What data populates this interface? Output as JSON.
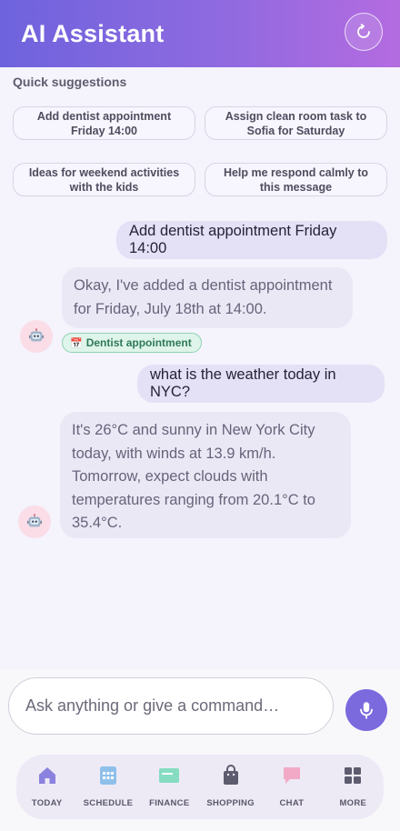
{
  "header": {
    "title": "AI Assistant",
    "refresh_icon": "refresh-icon"
  },
  "suggestions": {
    "label": "Quick suggestions",
    "chips": [
      {
        "line1": "Add dentist appointment",
        "line2": "Friday 14:00"
      },
      {
        "line1": "Assign clean room task to",
        "line2": "Sofia for Saturday"
      },
      {
        "line1": "Ideas for weekend activities",
        "line2": "with the kids"
      },
      {
        "line1": "Help me respond calmly to",
        "line2": "this message"
      }
    ]
  },
  "messages": [
    {
      "role": "user",
      "text": "Add dentist appointment Friday 14:00"
    },
    {
      "role": "assistant",
      "lines": [
        "Okay, I've added a dentist appointment",
        "for Friday, July 18th at 14:00."
      ],
      "tag": "Dentist appointment",
      "tag_icon": "calendar-icon"
    },
    {
      "role": "user",
      "text": "what is the weather today in NYC?"
    },
    {
      "role": "assistant",
      "lines": [
        "It's 26°C and sunny in New York City",
        "today, with winds at 13.9 km/h.",
        "Tomorrow, expect clouds with",
        "temperatures ranging from 20.1°C to",
        "35.4°C."
      ]
    }
  ],
  "composer": {
    "placeholder": "Ask anything or give a command…",
    "mic_icon": "microphone-icon"
  },
  "nav": [
    {
      "label": "TODAY",
      "icon": "home-icon",
      "color": "#8a82de"
    },
    {
      "label": "SCHEDULE",
      "icon": "calendar-grid-icon",
      "color": "#8ec0ea"
    },
    {
      "label": "FINANCE",
      "icon": "card-icon",
      "color": "#86dcc0"
    },
    {
      "label": "SHOPPING",
      "icon": "shopping-bag-icon",
      "color": "#5d5b6e"
    },
    {
      "label": "CHAT",
      "icon": "chat-bubble-icon",
      "color": "#f2a9c6"
    },
    {
      "label": "MORE",
      "icon": "grid-icon",
      "color": "#5d5b6e"
    }
  ],
  "colors": {
    "accent": "#7a6ade",
    "header_start": "#6e63dd",
    "header_end": "#b46be0",
    "tag_green": "#2f7a5a"
  }
}
